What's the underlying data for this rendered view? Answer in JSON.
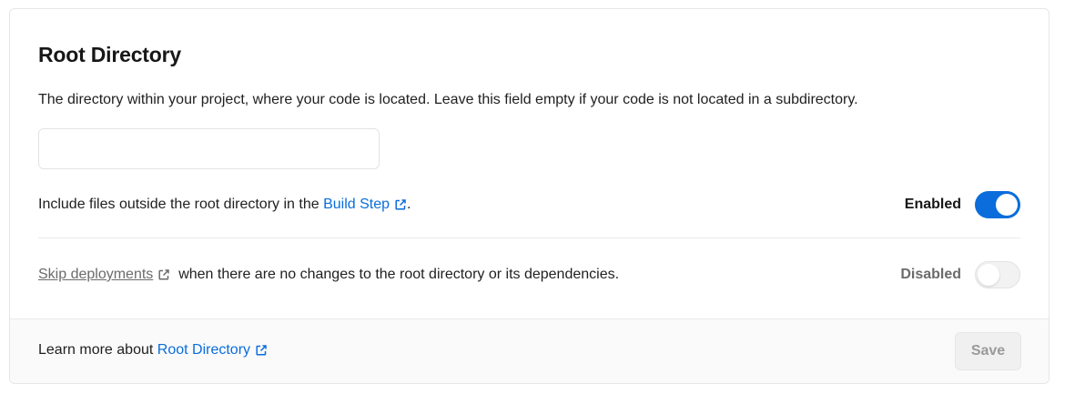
{
  "section": {
    "title": "Root Directory",
    "description": "The directory within your project, where your code is located. Leave this field empty if your code is not located in a subdirectory.",
    "input_value": ""
  },
  "include_files": {
    "text_before": "Include files outside the root directory in the",
    "link": "Build Step",
    "text_after": ".",
    "status": "Enabled",
    "enabled": true
  },
  "skip_deployments": {
    "link": "Skip deployments",
    "text_after": "when there are no changes to the root directory or its dependencies.",
    "status": "Disabled",
    "enabled": false
  },
  "footer": {
    "learn_more": "Learn more about",
    "link": "Root Directory",
    "save_label": "Save"
  },
  "colors": {
    "accent": "#0a6ddb",
    "muted": "#6b6b6b"
  },
  "icons": {
    "external_link": "external-link-icon"
  }
}
